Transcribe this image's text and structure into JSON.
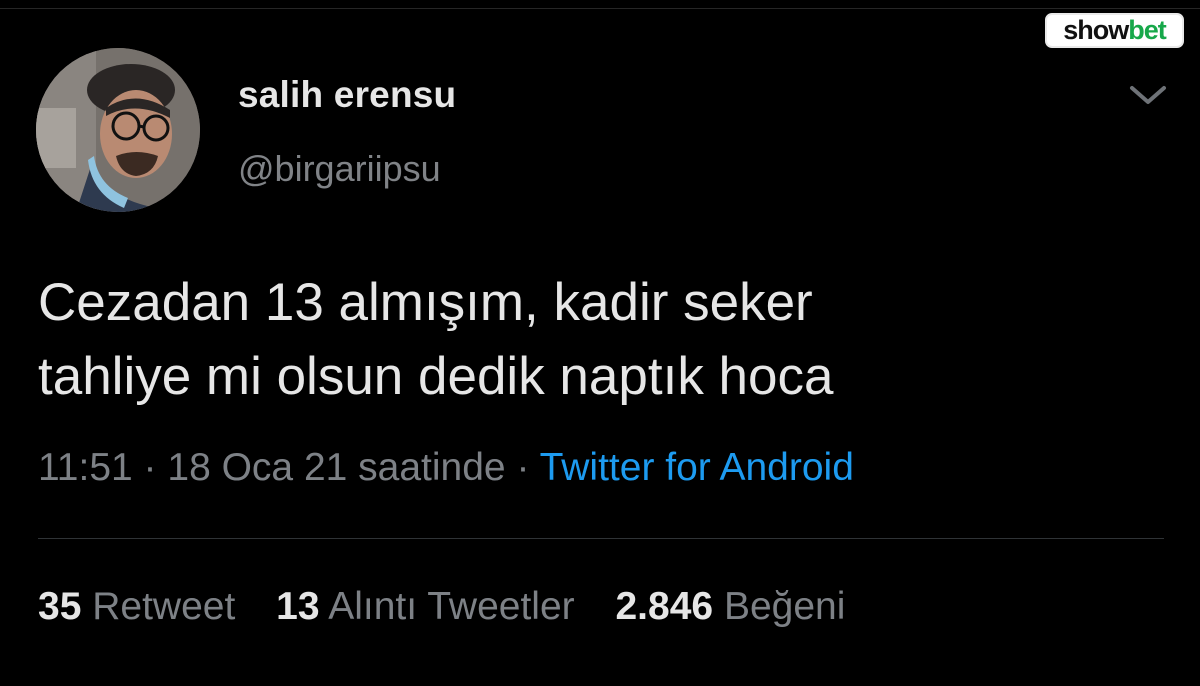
{
  "watermark": {
    "part1": "show",
    "part2": "bet"
  },
  "author": {
    "display_name": "salih erensu",
    "handle": "@birgariipsu"
  },
  "tweet": {
    "line1": "Cezadan 13 almışım, kadir seker",
    "line2": "tahliye mi olsun dedik naptık hoca"
  },
  "meta": {
    "time": "11:51",
    "sep1": " · ",
    "date": "18 Oca 21 saatinde",
    "sep2": " · ",
    "source": "Twitter for Android"
  },
  "stats": [
    {
      "value": "35",
      "label": "Retweet"
    },
    {
      "value": "13",
      "label": "Alıntı Tweetler"
    },
    {
      "value": "2.846",
      "label": "Beğeni"
    }
  ],
  "colors": {
    "background": "#000000",
    "link": "#1d9bf0",
    "muted": "#7d8186",
    "brand_green": "#17a84a"
  },
  "icons": {
    "menu": "chevron-down-icon"
  }
}
